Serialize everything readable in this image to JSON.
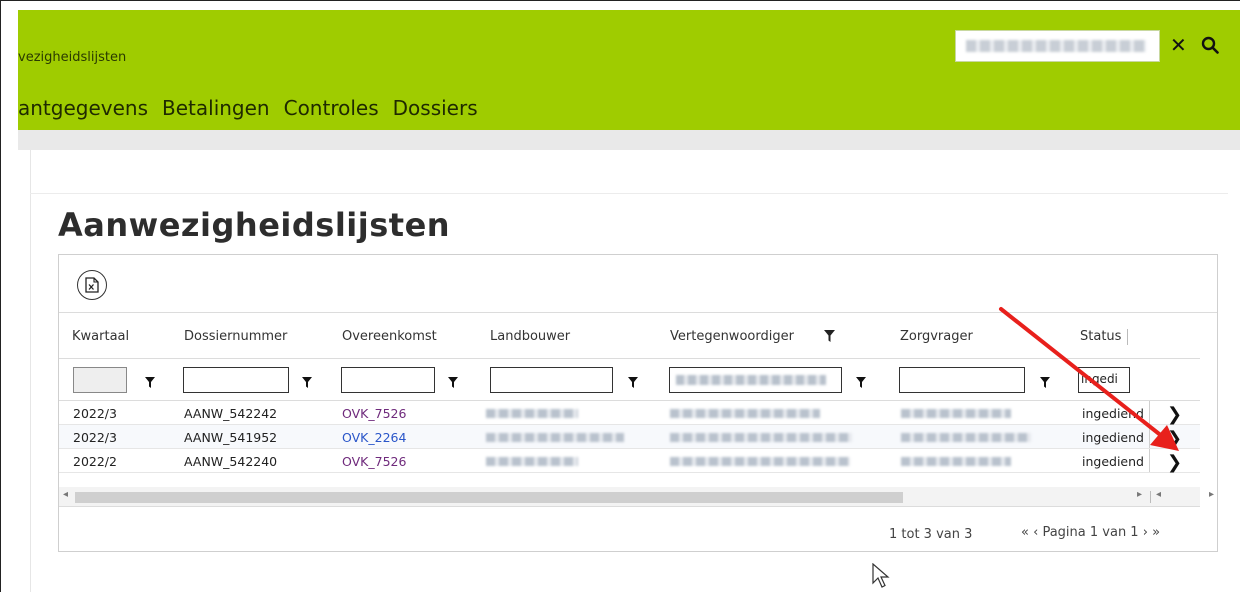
{
  "header": {
    "app_title": "vezigheidslijsten",
    "search_clear_symbol": "✕",
    "nav": [
      "antgegevens",
      "Betalingen",
      "Controles",
      "Dossiers"
    ],
    "accent": "#9fcc00"
  },
  "page": {
    "title": "Aanwezigheidslijsten"
  },
  "grid": {
    "columns": [
      "Kwartaal",
      "Dossiernummer",
      "Overeenkomst",
      "Landbouwer",
      "Vertegenwoordiger",
      "Zorgvrager",
      "Status"
    ],
    "filters": {
      "status_value": "ingedi"
    },
    "rows": [
      {
        "kwartaal": "2022/3",
        "dossier": "AANW_542242",
        "overeenkomst": "OVK_7526",
        "status": "ingediend"
      },
      {
        "kwartaal": "2022/3",
        "dossier": "AANW_541952",
        "overeenkomst": "OVK_2264",
        "status": "ingediend"
      },
      {
        "kwartaal": "2022/2",
        "dossier": "AANW_542240",
        "overeenkomst": "OVK_7526",
        "status": "ingediend"
      }
    ],
    "pager": {
      "count_text": "1 tot 3 van 3",
      "first": "«",
      "prev": "‹",
      "page_text": "Pagina 1 van 1",
      "next": "›",
      "last": "»"
    },
    "row_action_symbol": "❯"
  },
  "annotation": {
    "arrow_color": "#e8201c"
  }
}
